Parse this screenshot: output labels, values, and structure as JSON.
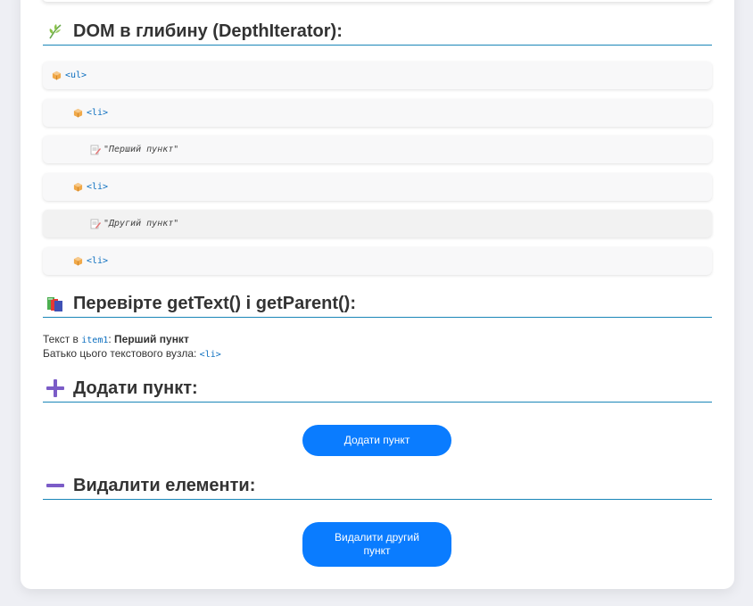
{
  "sections": {
    "depth": {
      "title": "DOM в глибину (DepthIterator):"
    },
    "check": {
      "title": "Перевірте getText() і getParent():"
    },
    "add": {
      "title": "Додати пункт:"
    },
    "remove": {
      "title": "Видалити елементи:"
    }
  },
  "tree": [
    {
      "kind": "element",
      "label": "<ul>"
    },
    {
      "kind": "element",
      "label": "<li>"
    },
    {
      "kind": "text",
      "label": "\"Перший пункт\""
    },
    {
      "kind": "element",
      "label": "<li>"
    },
    {
      "kind": "text",
      "label": "\"Другий пункт\""
    },
    {
      "kind": "element",
      "label": "<li>"
    }
  ],
  "check": {
    "text_prefix": "Текст в ",
    "text_code": "item1",
    "text_sep": ": ",
    "text_value": "Перший пункт",
    "parent_prefix": "Батько цього текстового вузла: ",
    "parent_code": "<li>"
  },
  "buttons": {
    "add_label": "Додати пункт",
    "remove_label": "Видалити другий пункт"
  },
  "colors": {
    "accent": "#0a7cff",
    "rule": "#1a86b8",
    "tag": "#0b6ebf",
    "icon_purple": "#7b5cc7"
  },
  "icons": {
    "depth": "herb-icon",
    "check": "books-icon",
    "add": "plus-icon",
    "remove": "minus-icon",
    "element": "package-icon",
    "text": "memo-icon"
  }
}
